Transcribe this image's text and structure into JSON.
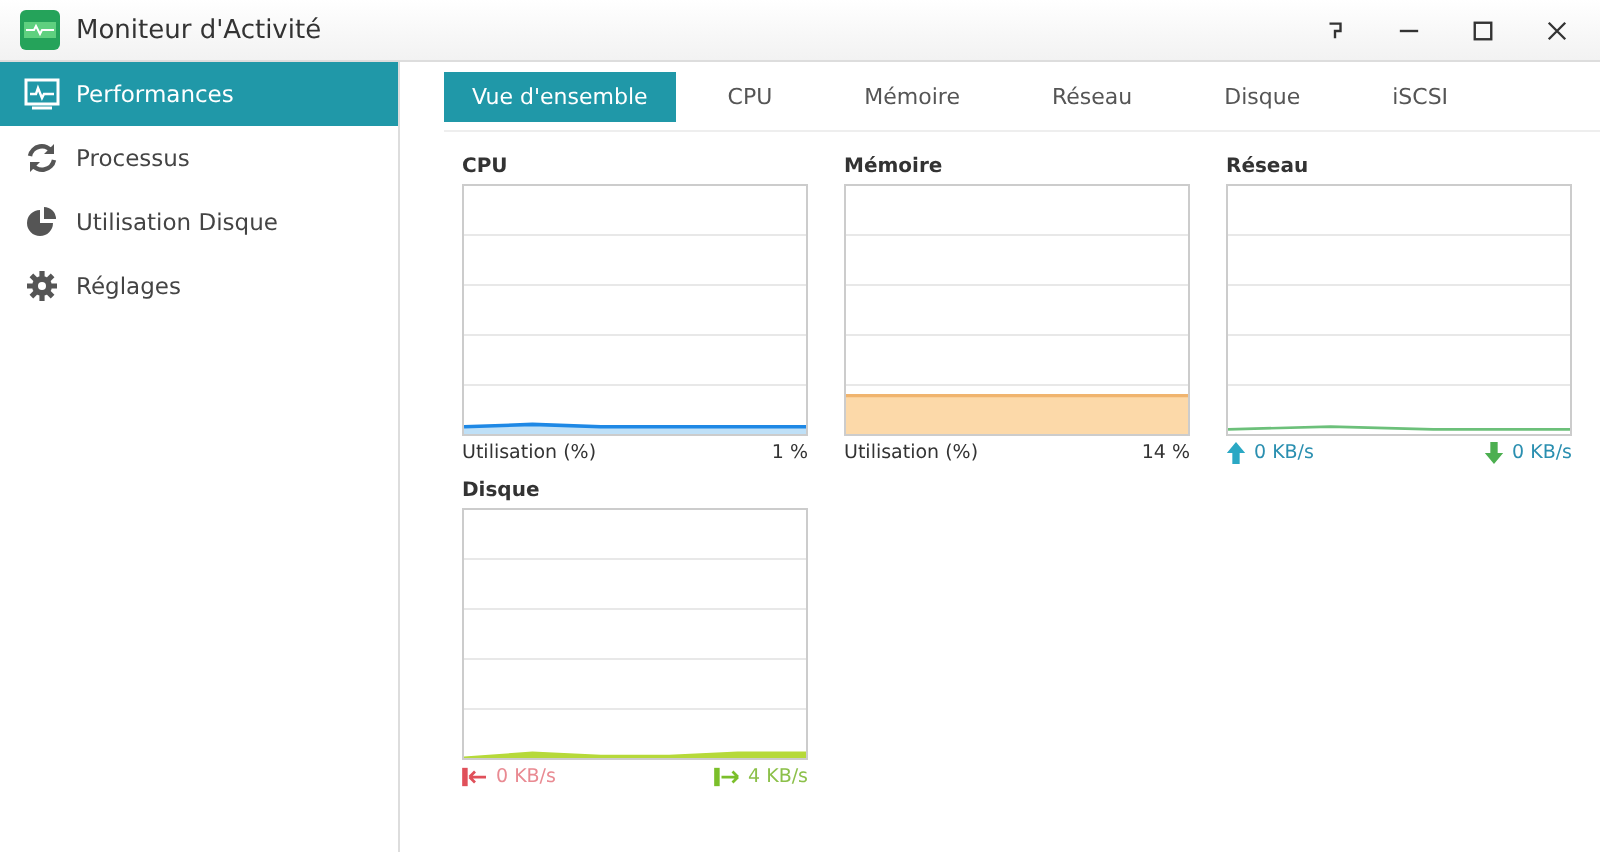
{
  "window": {
    "title": "Moniteur d'Activité"
  },
  "sidebar": {
    "items": [
      {
        "label": "Performances",
        "selected": true
      },
      {
        "label": "Processus",
        "selected": false
      },
      {
        "label": "Utilisation Disque",
        "selected": false
      },
      {
        "label": "Réglages",
        "selected": false
      }
    ]
  },
  "tabs": [
    {
      "label": "Vue d'ensemble",
      "selected": true
    },
    {
      "label": "CPU",
      "selected": false
    },
    {
      "label": "Mémoire",
      "selected": false
    },
    {
      "label": "Réseau",
      "selected": false
    },
    {
      "label": "Disque",
      "selected": false
    },
    {
      "label": "iSCSI",
      "selected": false
    }
  ],
  "panels": [
    {
      "kind": "cpu",
      "title": "CPU",
      "label": "Utilisation (%)",
      "value": "1 %"
    },
    {
      "kind": "memory",
      "title": "Mémoire",
      "label": "Utilisation (%)",
      "value": "14 %"
    },
    {
      "kind": "network",
      "title": "Réseau",
      "upload": "0 KB/s",
      "download": "0 KB/s"
    },
    {
      "kind": "disk",
      "title": "Disque",
      "read": "0 KB/s",
      "write": "4 KB/s"
    }
  ]
}
